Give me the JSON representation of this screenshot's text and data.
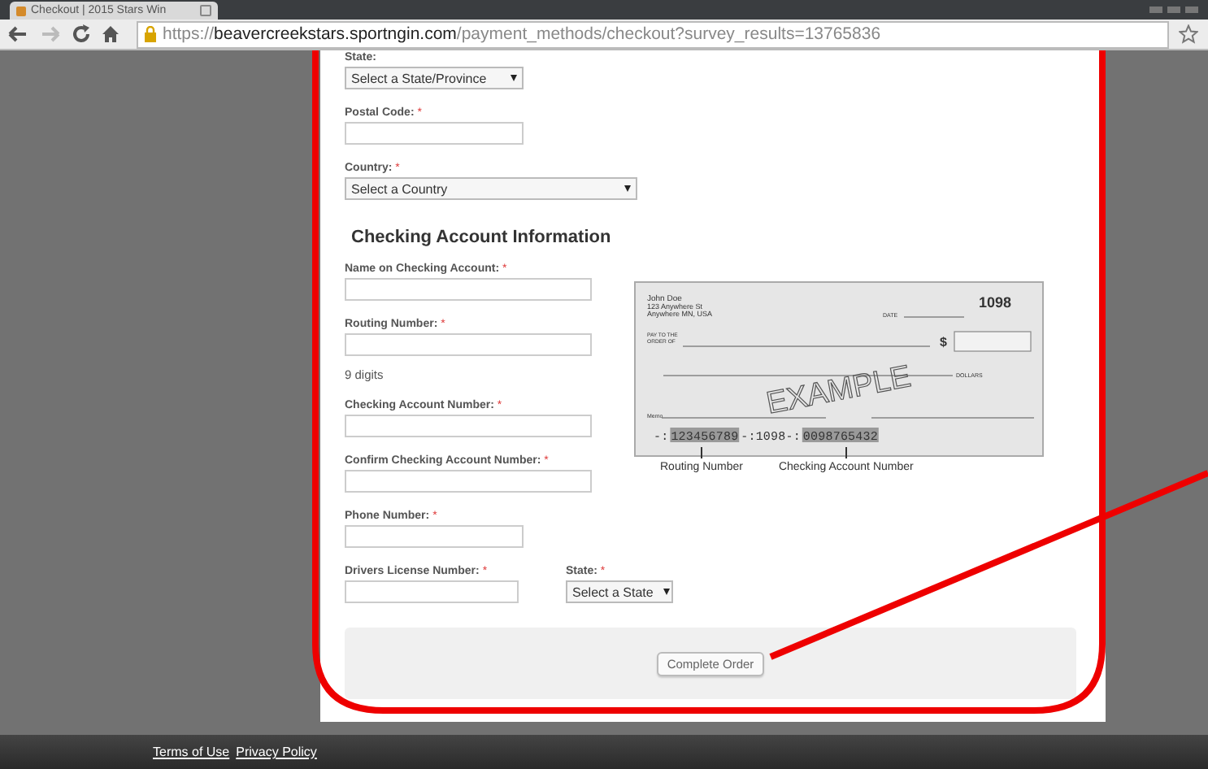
{
  "browser": {
    "tab_title": "Checkout | 2015 Stars Win",
    "url_scheme": "https://",
    "url_domain": "beavercreekstars.sportngin.com",
    "url_path": "/payment_methods/checkout?survey_results=13765836"
  },
  "form": {
    "top_fields": [
      {
        "kind": "select",
        "label": "State:",
        "value": "Select a State/Province"
      },
      {
        "kind": "input",
        "label": "Postal Code:",
        "mark": "*"
      },
      {
        "kind": "select",
        "label": "Country:",
        "mark": "*",
        "value": "Select a Country"
      }
    ],
    "section_title": "Checking Account Information",
    "account_fields": [
      {
        "kind": "input",
        "label": "Name on Checking Account:",
        "mark": "*"
      },
      {
        "kind": "input",
        "label": "Routing Number:",
        "mark": "*",
        "hint": "9 digits"
      },
      {
        "kind": "input",
        "label": "Checking Account Number:",
        "mark": "*"
      },
      {
        "kind": "input",
        "label": "Confirm Checking Account Number:",
        "mark": "*"
      },
      {
        "kind": "input",
        "label": "Phone Number:",
        "mark": "*"
      }
    ],
    "bottom_fields": [
      {
        "kind": "input",
        "label": "Drivers License Number:",
        "mark": "*"
      },
      {
        "kind": "select",
        "label": "State:",
        "mark": "*",
        "value": "Select a State"
      }
    ],
    "submit": "Complete Order"
  },
  "check": {
    "name": "John Doe",
    "address_lines": [
      "123 Anywhere St",
      "Anywhere MN, USA"
    ],
    "number": "1098",
    "date_label": "DATE",
    "pay_label_lines": [
      "PAY TO THE",
      "ORDER OF"
    ],
    "dollar_sign": "$",
    "dollars_label": "DOLLARS",
    "watermark": "EXAMPLE",
    "memo_label": "Memo",
    "micr": [
      {
        "text": "-:",
        "highlighted": false
      },
      {
        "text": "123456789",
        "highlighted": true
      },
      {
        "text": "-:1098-:",
        "highlighted": false
      },
      {
        "text": "0098765432",
        "highlighted": true
      }
    ],
    "captions": [
      "Routing Number",
      "Checking Account Number"
    ]
  },
  "footer_links": [
    "Terms of Use",
    "Privacy Policy"
  ]
}
